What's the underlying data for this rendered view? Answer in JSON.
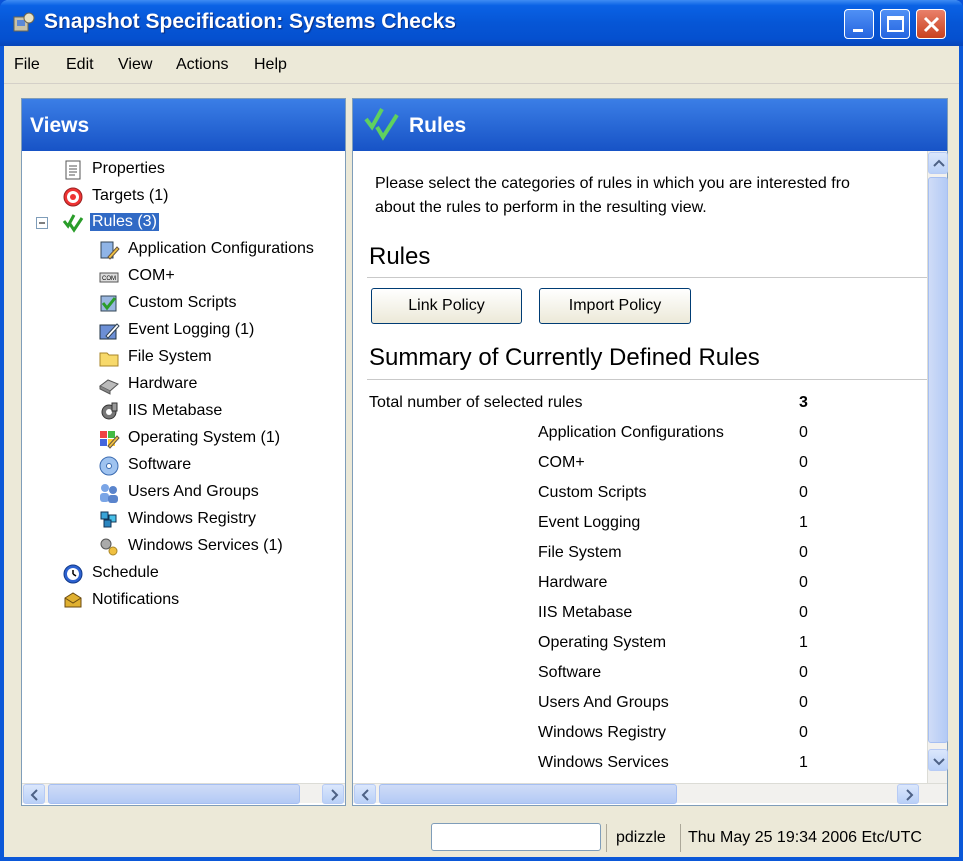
{
  "window": {
    "title": "Snapshot Specification: Systems Checks"
  },
  "menu": [
    "File",
    "Edit",
    "View",
    "Actions",
    "Help"
  ],
  "left_panel": {
    "title": "Views",
    "tree": [
      {
        "label": "Properties",
        "icon": "document-icon"
      },
      {
        "label": "Targets (1)",
        "icon": "target-icon"
      },
      {
        "label": "Rules (3)",
        "icon": "checkmarks-icon",
        "expanded": true,
        "selected": true
      },
      {
        "label": "Application Configurations",
        "icon": "app-config-icon"
      },
      {
        "label": "COM+",
        "icon": "com-icon"
      },
      {
        "label": "Custom Scripts",
        "icon": "script-icon"
      },
      {
        "label": "Event Logging (1)",
        "icon": "event-log-icon"
      },
      {
        "label": "File System",
        "icon": "folder-icon"
      },
      {
        "label": "Hardware",
        "icon": "hardware-icon"
      },
      {
        "label": "IIS Metabase",
        "icon": "iis-icon"
      },
      {
        "label": "Operating System (1)",
        "icon": "os-icon"
      },
      {
        "label": "Software",
        "icon": "software-icon"
      },
      {
        "label": "Users And Groups",
        "icon": "users-icon"
      },
      {
        "label": "Windows Registry",
        "icon": "registry-icon"
      },
      {
        "label": "Windows Services (1)",
        "icon": "services-icon"
      },
      {
        "label": "Schedule",
        "icon": "clock-icon"
      },
      {
        "label": "Notifications",
        "icon": "notification-icon"
      }
    ]
  },
  "right_panel": {
    "title": "Rules",
    "intro_line1": "Please select the categories of rules in which you are interested fro",
    "intro_line2": "about the rules to perform in the resulting view.",
    "rules_heading": "Rules",
    "link_policy": "Link Policy",
    "import_policy": "Import Policy",
    "summary_heading": "Summary of Currently Defined Rules",
    "total_label": "Total number of selected rules",
    "total_value": "3",
    "categories": [
      {
        "name": "Application Configurations",
        "count": "0"
      },
      {
        "name": "COM+",
        "count": "0"
      },
      {
        "name": "Custom Scripts",
        "count": "0"
      },
      {
        "name": "Event Logging",
        "count": "1"
      },
      {
        "name": "File System",
        "count": "0"
      },
      {
        "name": "Hardware",
        "count": "0"
      },
      {
        "name": "IIS Metabase",
        "count": "0"
      },
      {
        "name": "Operating System",
        "count": "1"
      },
      {
        "name": "Software",
        "count": "0"
      },
      {
        "name": "Users And Groups",
        "count": "0"
      },
      {
        "name": "Windows Registry",
        "count": "0"
      },
      {
        "name": "Windows Services",
        "count": "1"
      }
    ]
  },
  "status": {
    "user": "pdizzle",
    "datetime": "Thu May 25 19:34 2006 Etc/UTC"
  },
  "colors": {
    "title_blue": "#0656d6",
    "selection": "#316ac5",
    "close_red": "#c9421f"
  }
}
